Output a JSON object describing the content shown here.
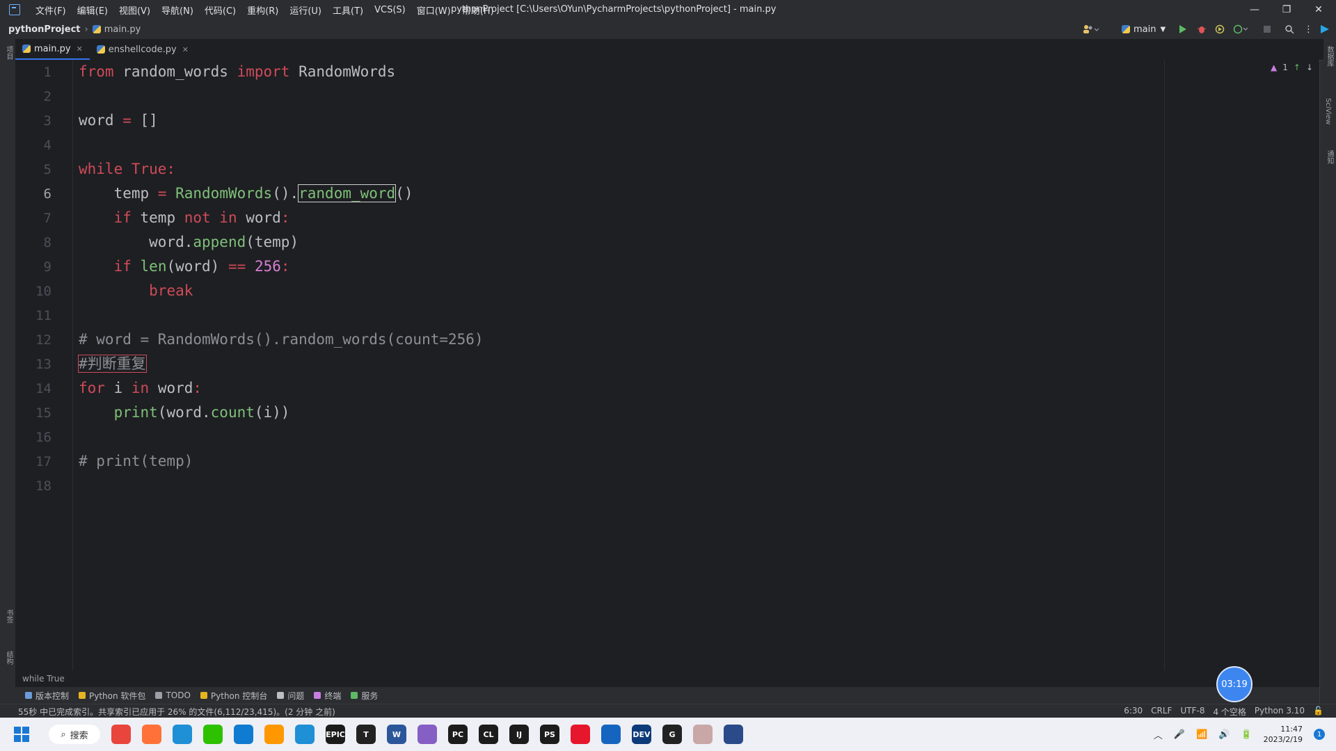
{
  "title_bar": {
    "menus": [
      "文件(F)",
      "编辑(E)",
      "视图(V)",
      "导航(N)",
      "代码(C)",
      "重构(R)",
      "运行(U)",
      "工具(T)",
      "VCS(S)",
      "窗口(W)",
      "帮助(H)"
    ],
    "window_title": "pythonProject [C:\\Users\\OYun\\PycharmProjects\\pythonProject] - main.py",
    "controls": {
      "minimize": "—",
      "restore": "❐",
      "close": "✕"
    }
  },
  "nav_bar": {
    "project": "pythonProject",
    "file": "main.py",
    "run_config": "main"
  },
  "tabs": [
    {
      "label": "main.py",
      "active": true
    },
    {
      "label": "enshellcode.py",
      "active": false
    }
  ],
  "editor": {
    "current_line": 6,
    "inspection_count": "1",
    "line_numbers": [
      "1",
      "2",
      "3",
      "4",
      "5",
      "6",
      "7",
      "8",
      "9",
      "10",
      "11",
      "12",
      "13",
      "14",
      "15",
      "16",
      "17",
      "18"
    ]
  },
  "breadcrumbs": "while True",
  "tool_windows": [
    "版本控制",
    "Python 软件包",
    "TODO",
    "Python 控制台",
    "问题",
    "终端",
    "服务"
  ],
  "status_bar": {
    "message": "55秒 中已完成索引。共享索引已应用于 26% 的文件(6,112/23,415)。(2 分钟 之前)",
    "caret": "6:30",
    "line_sep": "CRLF",
    "encoding": "UTF-8",
    "indent": "4 个空格",
    "interpreter": "Python 3.10"
  },
  "timer": "03:19",
  "left_strip_labels": [
    "项目",
    "书签",
    "结构"
  ],
  "right_strip_labels": [
    "数据库",
    "SciView",
    "通知"
  ],
  "taskbar": {
    "search_label": "搜索",
    "apps": [
      {
        "name": "chrome",
        "label": "",
        "color": "#e8453c"
      },
      {
        "name": "firefox",
        "label": "",
        "color": "#ff7139"
      },
      {
        "name": "edge",
        "label": "",
        "color": "#1f8fd6"
      },
      {
        "name": "wechat",
        "label": "",
        "color": "#2dc100"
      },
      {
        "name": "vscode",
        "label": "",
        "color": "#0f7bd1"
      },
      {
        "name": "sublime",
        "label": "",
        "color": "#ff9800"
      },
      {
        "name": "app-frame",
        "label": "",
        "color": "#1f8fd6"
      },
      {
        "name": "epic",
        "label": "EPIC",
        "color": "#1b1b1b"
      },
      {
        "name": "typora",
        "label": "T",
        "color": "#222222"
      },
      {
        "name": "word",
        "label": "W",
        "color": "#2b579a"
      },
      {
        "name": "visual-studio",
        "label": "",
        "color": "#865fc5"
      },
      {
        "name": "pycharm",
        "label": "PC",
        "color": "#1c1c1c"
      },
      {
        "name": "clion",
        "label": "CL",
        "color": "#1c1c1c"
      },
      {
        "name": "intellij",
        "label": "IJ",
        "color": "#1c1c1c"
      },
      {
        "name": "phpstorm",
        "label": "PS",
        "color": "#1c1c1c"
      },
      {
        "name": "weibo",
        "label": "",
        "color": "#e6162d"
      },
      {
        "name": "app-blue",
        "label": "",
        "color": "#1565c0"
      },
      {
        "name": "devcpp",
        "label": "DEV",
        "color": "#0d3b7a"
      },
      {
        "name": "app-g",
        "label": "G",
        "color": "#222222"
      },
      {
        "name": "anime",
        "label": "",
        "color": "#c9a7a7"
      },
      {
        "name": "app-cat",
        "label": "",
        "color": "#2a4a8a"
      }
    ],
    "clock_time": "11:47",
    "clock_date": "2023/2/19",
    "notifications": "1"
  }
}
